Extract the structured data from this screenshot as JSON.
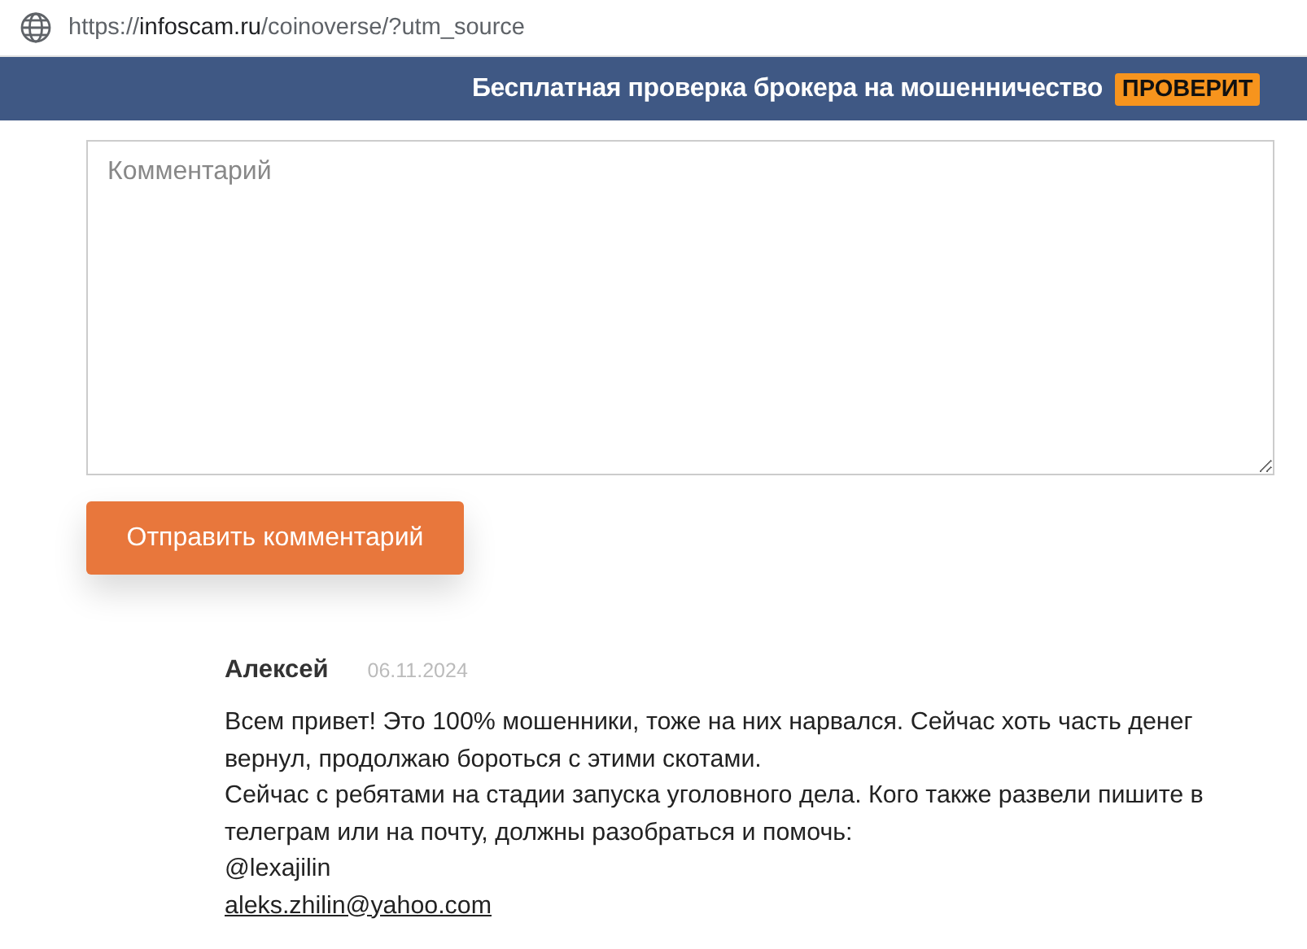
{
  "address_bar": {
    "scheme": "https://",
    "host": "infoscam.ru",
    "path": "/coinoverse/?utm_source"
  },
  "banner": {
    "text": "Бесплатная проверка брокера на мошенничество",
    "badge": "ПРОВЕРИТ"
  },
  "comment_form": {
    "placeholder": "Комментарий",
    "submit": "Отправить комментарий"
  },
  "comments": [
    {
      "author": "Алексей",
      "date": "06.11.2024",
      "paragraphs": [
        "Всем привет! Это 100% мошенники, тоже на них нарвался. Сейчас хоть часть денег вернул, продолжаю бороться с этими скотами.",
        "Сейчас с ребятами на стадии запуска уголовного дела. Кого также развели пишите в телеграм или на почту, должны разобраться и помочь:",
        "@lexajilin"
      ],
      "email": "aleks.zhilin@yahoo.com"
    }
  ]
}
